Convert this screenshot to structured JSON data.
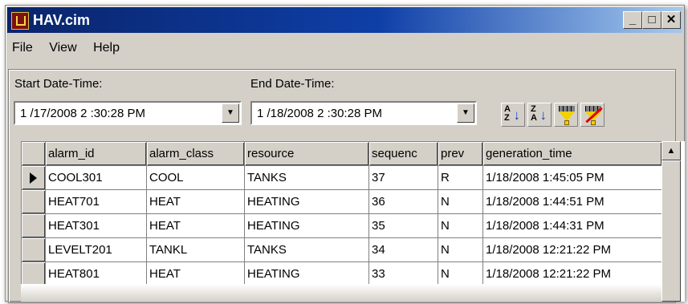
{
  "window": {
    "title": "HAV.cim",
    "minimize_label": "_",
    "maximize_label": "□",
    "close_label": "✕"
  },
  "menu": [
    {
      "label": "File"
    },
    {
      "label": "View"
    },
    {
      "label": "Help"
    }
  ],
  "filters": {
    "start_label": "Start Date-Time:",
    "start_value": "1 /17/2008  2 :30:28 PM",
    "end_label": "End Date-Time:",
    "end_value": "1 /18/2008  2 :30:28 PM",
    "dropdown_glyph": "▼"
  },
  "toolbar": {
    "sort_ascending_icon": "sort-ascending-icon",
    "sort_descending_icon": "sort-descending-icon",
    "filter_icon": "filter-icon",
    "clear_filter_icon": "clear-filter-icon",
    "sort_ascending_text": [
      "A",
      "Z"
    ],
    "sort_descending_text": [
      "Z",
      "A"
    ],
    "sort_arrow": "↓"
  },
  "grid": {
    "columns": [
      "alarm_id",
      "alarm_class",
      "resource",
      "sequenc",
      "prev",
      "generation_time"
    ],
    "rows": [
      [
        "COOL301",
        "COOL",
        "TANKS",
        "37",
        "R",
        "1/18/2008 1:45:05 PM"
      ],
      [
        "HEAT701",
        "HEAT",
        "HEATING",
        "36",
        "N",
        "1/18/2008 1:44:51 PM"
      ],
      [
        "HEAT301",
        "HEAT",
        "HEATING",
        "35",
        "N",
        "1/18/2008 1:44:31 PM"
      ],
      [
        "LEVELT201",
        "TANKL",
        "TANKS",
        "34",
        "N",
        "1/18/2008 12:21:22 PM"
      ],
      [
        "HEAT801",
        "HEAT",
        "HEATING",
        "33",
        "N",
        "1/18/2008 12:21:22 PM"
      ]
    ],
    "current_row": 0
  },
  "scrollbar": {
    "up_glyph": "▲"
  },
  "colors": {
    "titlebar_start": "#0a246a",
    "titlebar_end": "#a6caf0",
    "face": "#d4d0c8"
  }
}
